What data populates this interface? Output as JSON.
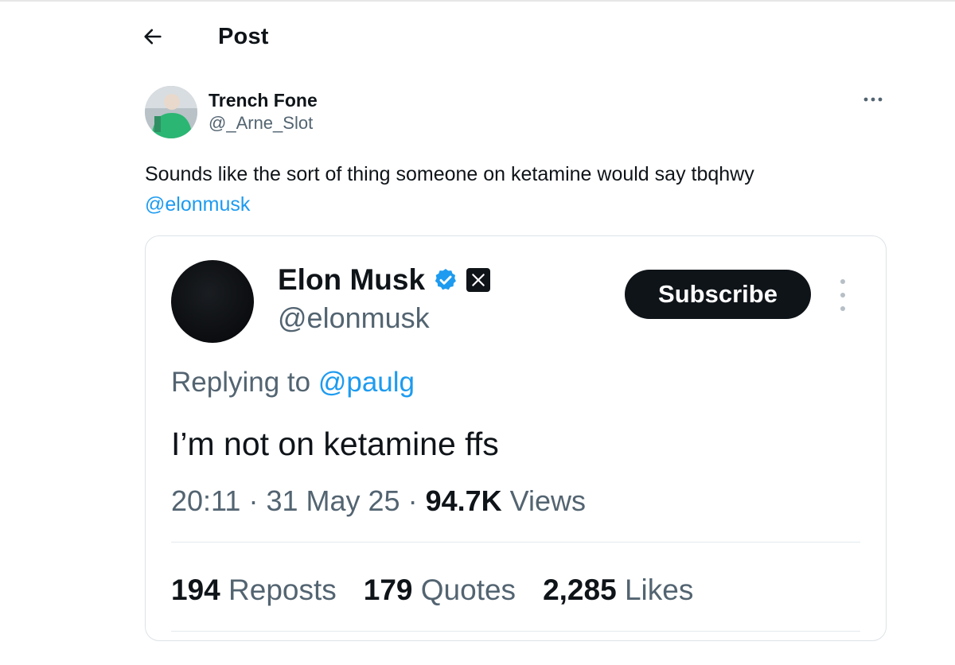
{
  "header": {
    "title": "Post"
  },
  "icons": {
    "back": "arrow-left-icon",
    "more": "more-horizontal-icon",
    "verified": "verified-badge-icon",
    "x": "x-logo-icon",
    "kebab": "more-vertical-icon"
  },
  "post": {
    "author": {
      "display_name": "Trench Fone",
      "handle": "@_Arne_Slot"
    },
    "text": "Sounds like the sort of thing someone on ketamine would say tbqhwy",
    "mention": "@elonmusk"
  },
  "quoted": {
    "name": "Elon Musk",
    "handle": "@elonmusk",
    "subscribe_label": "Subscribe",
    "replying_prefix": "Replying to",
    "replying_to": "@paulg",
    "body": "I’m not on ketamine ffs",
    "time": "20:11",
    "date": "31 May 25",
    "views_count": "94.7K",
    "views_label": "Views",
    "stats": [
      {
        "count": "194",
        "label": "Reposts"
      },
      {
        "count": "179",
        "label": "Quotes"
      },
      {
        "count": "2,285",
        "label": "Likes"
      }
    ]
  },
  "colors": {
    "accent": "#1d9bf0",
    "text": "#0f1419",
    "muted": "#536471",
    "button": "#0f1419"
  }
}
